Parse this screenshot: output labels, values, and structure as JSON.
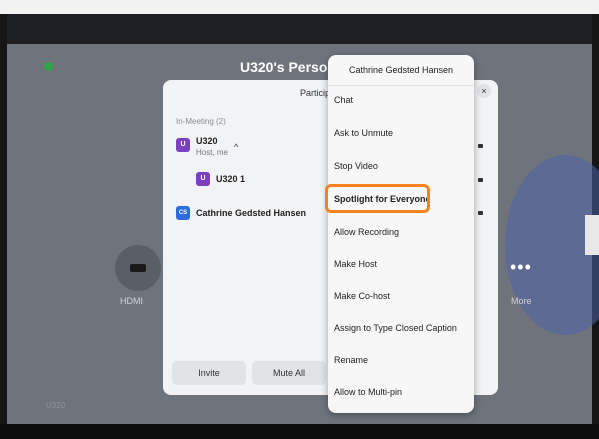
{
  "meeting": {
    "title": "U320's Personal"
  },
  "participants_panel": {
    "title": "Particip",
    "close_glyph": "×",
    "section_label": "In-Meeting (2)",
    "rows": [
      {
        "avatar_text": "U",
        "name": "U320",
        "subtitle": "Host, me",
        "avatar_color": "#7c3fbe"
      },
      {
        "avatar_text": "U",
        "name": "U320 1",
        "subtitle": "",
        "avatar_color": "#7c3fbe"
      },
      {
        "avatar_text": "CS",
        "name": "Cathrine Gedsted Hansen",
        "subtitle": "",
        "avatar_color": "#2d6cdf"
      }
    ],
    "footer": {
      "invite": "Invite",
      "mute_all": "Mute All"
    }
  },
  "context_menu": {
    "header": "Cathrine Gedsted Hansen",
    "items": [
      "Chat",
      "Ask to Unmute",
      "Stop Video",
      "Spotlight for Everyone",
      "Allow Recording",
      "Make Host",
      "Make Co-host",
      "Assign to Type Closed Caption",
      "Rename",
      "Allow to Multi-pin"
    ],
    "highlighted_item": "Spotlight for Everyone",
    "highlight_color": "#f58220"
  },
  "home_tiles": {
    "hdmi_label": "HDMI",
    "more_label": "More",
    "more_glyph": "•••"
  },
  "room_label": "U320",
  "colors": {
    "status_green": "#2ea64a",
    "zoom_purple": "#7c3fbe",
    "zoom_blue": "#2d6cdf"
  }
}
